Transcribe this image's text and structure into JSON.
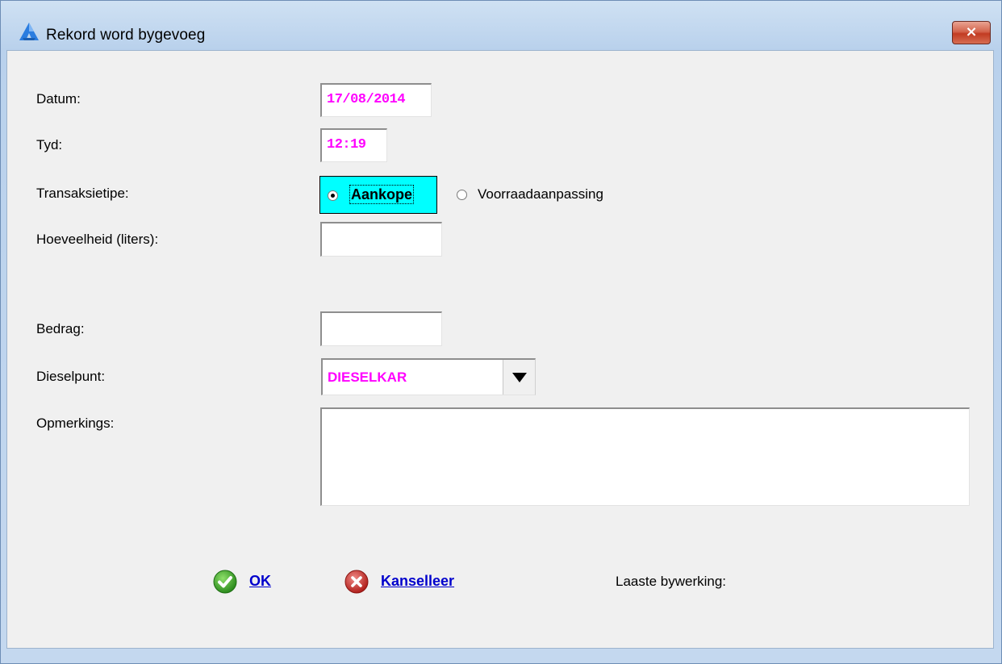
{
  "window": {
    "title": "Rekord word bygevoeg",
    "close_label": "×"
  },
  "form": {
    "datum_label": "Datum:",
    "datum_value": "17/08/2014",
    "tyd_label": "Tyd:",
    "tyd_value": "12:19",
    "transaksietipe_label": "Transaksietipe:",
    "transaksietipe_options": [
      "Aankope",
      "Voorraadaanpassing"
    ],
    "transaksietipe_selected": "Aankope",
    "hoeveelheid_label": "Hoeveelheid (liters):",
    "hoeveelheid_value": "",
    "bedrag_label": "Bedrag:",
    "bedrag_value": "",
    "dieselpunt_label": "Dieselpunt:",
    "dieselpunt_value": "DIESELKAR",
    "opmerkings_label": "Opmerkings:",
    "opmerkings_value": ""
  },
  "actions": {
    "ok_label": "OK",
    "cancel_label": "Kanselleer",
    "last_update_label": "Laaste bywerking:"
  },
  "icons": {
    "app": "app-logo-icon",
    "ok": "checkmark-icon",
    "cancel": "cancel-x-icon",
    "dropdown": "dropdown-arrow-icon"
  },
  "colors": {
    "value_text": "#ff00ff",
    "selected_radio_bg": "#00ffff",
    "link": "#0000cc",
    "close_button": "#c23b22"
  }
}
